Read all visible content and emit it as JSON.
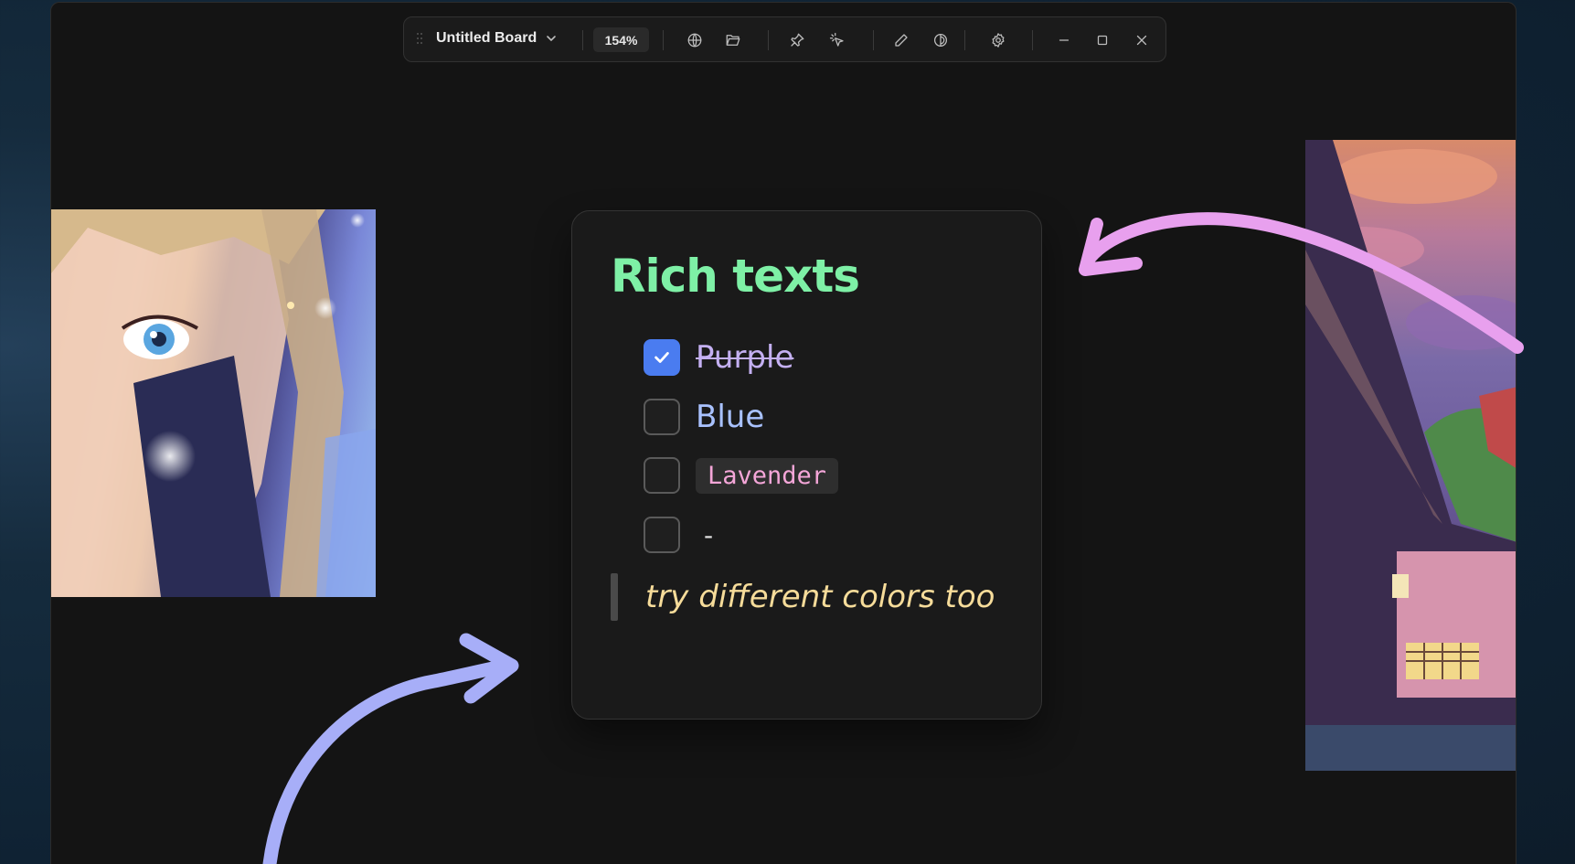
{
  "toolbar": {
    "title": "Untitled Board",
    "zoom": "154%",
    "icons": [
      "globe-icon",
      "folder-icon",
      "pin-icon",
      "magic-cursor-icon",
      "pencil-icon",
      "theme-icon",
      "gear-icon",
      "minimize-icon",
      "maximize-icon",
      "close-icon"
    ]
  },
  "card": {
    "title": "Rich texts",
    "title_color": "#7ef0a6",
    "todos": [
      {
        "label": "Purple",
        "checked": true,
        "color": "#c4b0f2"
      },
      {
        "label": "Blue",
        "checked": false,
        "color": "#a9c2ff"
      },
      {
        "label": "Lavender",
        "checked": false,
        "color": "#f4a6d8",
        "code": true
      },
      {
        "label": "-",
        "checked": false,
        "color": "#e0e0e0"
      }
    ],
    "quote": "try different colors too",
    "quote_color": "#f6dc9a"
  },
  "decorations": {
    "arrow_pink": "#e8a0ee",
    "arrow_blue": "#a7aef8"
  }
}
